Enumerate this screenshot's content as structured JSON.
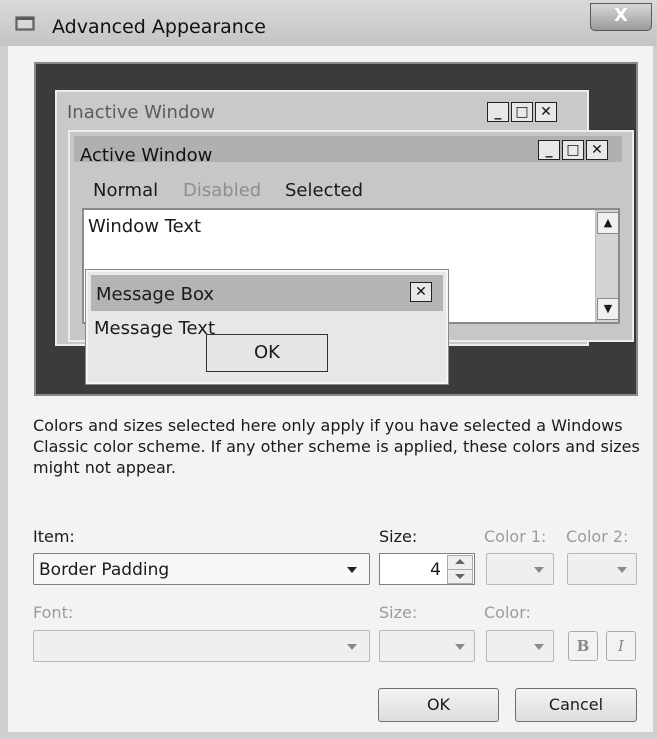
{
  "window": {
    "title": "Advanced Appearance",
    "close_glyph": "X"
  },
  "preview": {
    "inactive_title": "Inactive Window",
    "active_title": "Active Window",
    "menu": {
      "normal": "Normal",
      "disabled": "Disabled",
      "selected": "Selected"
    },
    "window_text": "Window Text",
    "message_box": {
      "title": "Message Box",
      "text": "Message Text",
      "ok_label": "OK"
    },
    "caption_buttons": {
      "minimize": "_",
      "maximize": "□",
      "close": "✕"
    }
  },
  "info_text": "Colors and sizes selected here only apply if you have selected a Windows Classic color scheme. If any other scheme is applied, these colors and sizes might not appear.",
  "item_section": {
    "item_label": "Item:",
    "item_value": "Border Padding",
    "size_label": "Size:",
    "size_value": "4",
    "color1_label": "Color 1:",
    "color2_label": "Color 2:"
  },
  "font_section": {
    "font_label": "Font:",
    "size_label": "Size:",
    "color_label": "Color:",
    "bold_label": "B",
    "italic_label": "I"
  },
  "buttons": {
    "ok": "OK",
    "cancel": "Cancel"
  }
}
